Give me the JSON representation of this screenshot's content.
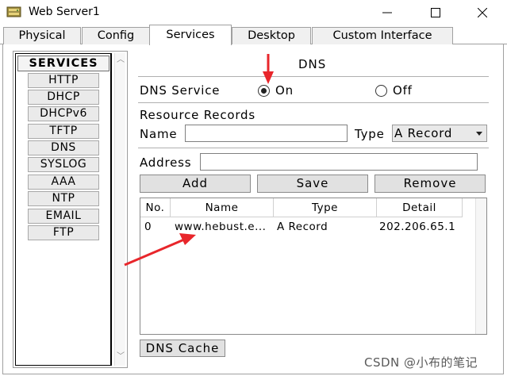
{
  "window": {
    "title": "Web Server1",
    "minimize_icon": "minimize-icon",
    "maximize_icon": "maximize-icon",
    "close_icon": "close-icon"
  },
  "tabs": [
    {
      "label": "Physical",
      "active": false
    },
    {
      "label": "Config",
      "active": false
    },
    {
      "label": "Services",
      "active": true
    },
    {
      "label": "Desktop",
      "active": false
    },
    {
      "label": "Custom Interface",
      "active": false
    }
  ],
  "services": {
    "header": "SERVICES",
    "items": [
      "HTTP",
      "DHCP",
      "DHCPv6",
      "TFTP",
      "DNS",
      "SYSLOG",
      "AAA",
      "NTP",
      "EMAIL",
      "FTP"
    ]
  },
  "dns": {
    "title": "DNS",
    "service_label": "DNS Service",
    "on_label": "On",
    "off_label": "Off",
    "service_state": "On",
    "resource_records_label": "Resource Records",
    "name_label": "Name",
    "name_value": "",
    "type_label": "Type",
    "type_value": "A Record",
    "address_label": "Address",
    "address_value": "",
    "add_button": "Add",
    "save_button": "Save",
    "remove_button": "Remove",
    "dns_cache_button": "DNS Cache",
    "table": {
      "columns": [
        "No.",
        "Name",
        "Type",
        "Detail"
      ],
      "rows": [
        {
          "no": "0",
          "name": "www.hebust.e...",
          "type": "A Record",
          "detail": "202.206.65.1"
        }
      ]
    }
  },
  "watermark": "CSDN @小布的笔记",
  "annotation_color": "#e8262b"
}
